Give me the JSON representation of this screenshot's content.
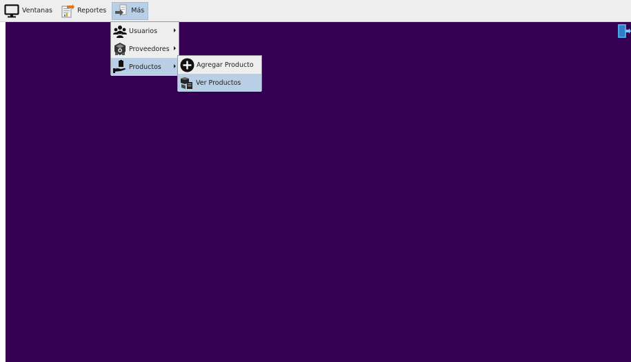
{
  "menubar": {
    "items": [
      {
        "label": "Ventanas",
        "icon": "monitor-icon"
      },
      {
        "label": "Reportes",
        "icon": "report-icon"
      },
      {
        "label": "Más",
        "icon": "arrow-right-icon"
      }
    ]
  },
  "mas_menu": {
    "items": [
      {
        "label": "Usuarios",
        "icon": "users-icon",
        "has_submenu": true
      },
      {
        "label": "Proveedores",
        "icon": "suppliers-icon",
        "has_submenu": true
      },
      {
        "label": "Productos",
        "icon": "hand-product-icon",
        "has_submenu": true,
        "selected": true
      }
    ]
  },
  "productos_menu": {
    "items": [
      {
        "label": "Agregar Producto",
        "icon": "plus-circle-icon"
      },
      {
        "label": "Ver Productos",
        "icon": "boxes-icon",
        "selected": true
      }
    ]
  },
  "desktop": {
    "background_color": "#360052"
  },
  "colors": {
    "selection": "#b8cfe5",
    "menu_background": "#eeeeee"
  }
}
